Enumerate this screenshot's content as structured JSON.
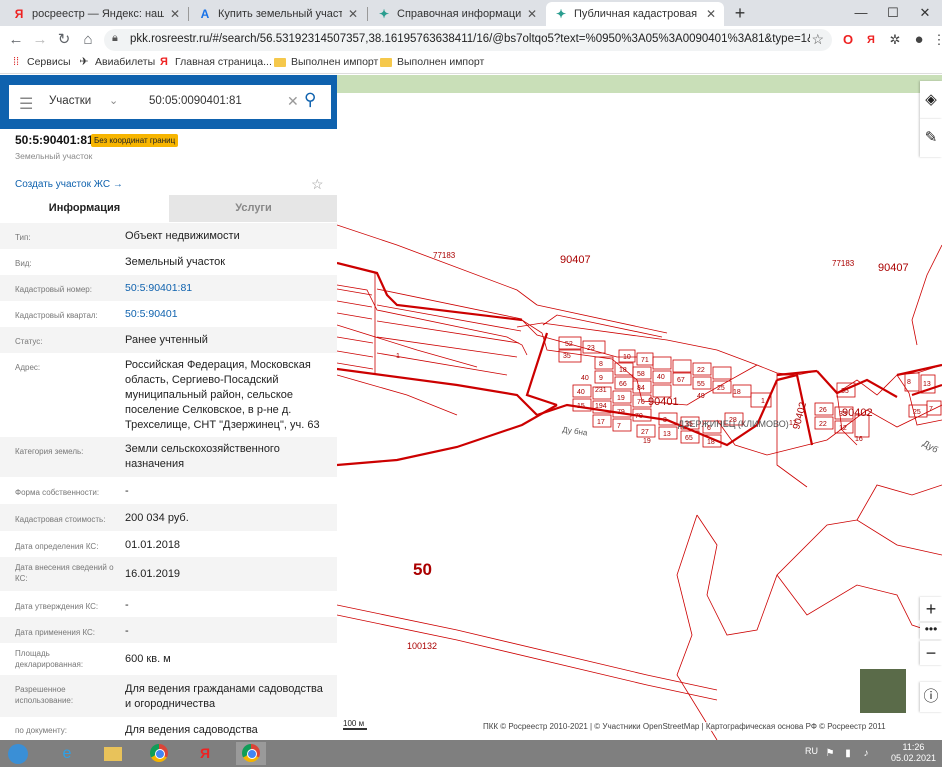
{
  "browser": {
    "tabs": [
      {
        "title": "росреестр — Яндекс: нашлось",
        "favicon": "Я"
      },
      {
        "title": "Купить земельный участок, дом",
        "favicon": "A"
      },
      {
        "title": "Справочная информация по об",
        "favicon": "✦"
      },
      {
        "title": "Публичная кадастровая карта",
        "favicon": "✦"
      }
    ],
    "url": "pkk.rosreestr.ru/#/search/56.53192314507357,38.16195763638411/16/@bs7oltqo5?text=%0950%3A05%3A0090401%3A81&type=1&opened=..."
  },
  "bookmarks": [
    {
      "label": "Сервисы",
      "icon": "apps-grid-icon"
    },
    {
      "label": "Авиабилеты",
      "icon": "plane-icon"
    },
    {
      "label": "Главная страница...",
      "icon": "yandex-icon"
    },
    {
      "label": "Выполнен импорт",
      "icon": "folder-icon"
    },
    {
      "label": "Выполнен импорт",
      "icon": "folder-icon"
    }
  ],
  "search": {
    "type_label": "Участки",
    "query": "50:05:0090401:81"
  },
  "object": {
    "number": "50:5:90401:81",
    "badge": "Без координат границ",
    "subtitle": "Земельный участок",
    "create_link": "Создать участок ЖС →"
  },
  "info_tabs": {
    "info": "Информация",
    "services": "Услуги"
  },
  "properties": [
    {
      "label": "Тип:",
      "value": "Объект недвижимости"
    },
    {
      "label": "Вид:",
      "value": "Земельный участок"
    },
    {
      "label": "Кадастровый номер:",
      "value": "50:5:90401:81"
    },
    {
      "label": "Кадастровый квартал:",
      "value": "50:5:90401"
    },
    {
      "label": "Статус:",
      "value": "Ранее учтенный"
    },
    {
      "label": "Адрес:",
      "value": "Российская Федерация, Московская область, Сергиево-Посадский муниципальный район, сельское поселение Селковское, в р-не д. Трехселище, СНТ \"Дзержинец\", уч. 63"
    },
    {
      "label": "Категория земель:",
      "value": "Земли сельскохозяйственного назначения"
    },
    {
      "label": "Форма собственности:",
      "value": "-"
    },
    {
      "label": "Кадастровая стоимость:",
      "value": "200 034 руб."
    },
    {
      "label": "Дата определения КС:",
      "value": "01.01.2018"
    },
    {
      "label": "Дата внесения сведений о КС:",
      "value": "16.01.2019"
    },
    {
      "label": "Дата утверждения КС:",
      "value": "-"
    },
    {
      "label": "Дата применения КС:",
      "value": "-"
    },
    {
      "label": "Площадь декларированная:",
      "value": "600 кв. м"
    },
    {
      "label": "Разрешенное использование:",
      "value": "Для ведения гражданами садоводства и огородничества"
    },
    {
      "label": "по документу:",
      "value": "Для ведения садоводства"
    }
  ],
  "map": {
    "labels": {
      "q77183a": "77183",
      "q90407a": "90407",
      "q77183b": "77183",
      "q90407b": "90407",
      "q90401": "90401",
      "q90402a": "90402",
      "q90402b": "90402",
      "district": "50",
      "q100132": "100132",
      "village": "ДЗЕРЖИНЕЦ (КЛИМОВО)",
      "road1": "Ду бна",
      "road2": "Дуб",
      "one": "1"
    },
    "parcels": [
      "52",
      "35",
      "23",
      "10",
      "71",
      "40",
      "67",
      "22",
      "8",
      "18",
      "58",
      "55",
      "84",
      "76",
      "9",
      "66",
      "49",
      "231",
      "40",
      "25",
      "194",
      "19",
      "79",
      "70",
      "1",
      "15",
      "17",
      "40",
      "7",
      "27",
      "3",
      "13",
      "65",
      "6",
      "28",
      "19",
      "15",
      "18",
      "17",
      "26",
      "22",
      "33",
      "12",
      "35",
      "8",
      "13",
      "16",
      "7",
      "25",
      "18"
    ],
    "scale": "100 м",
    "copyright": "ПКК © Росреестр 2010-2021 | © Участники OpenStreetMap | Картографическая основа РФ © Росреестр 2011"
  },
  "taskbar": {
    "lang": "RU",
    "time": "11:26",
    "date": "05.02.2021"
  }
}
